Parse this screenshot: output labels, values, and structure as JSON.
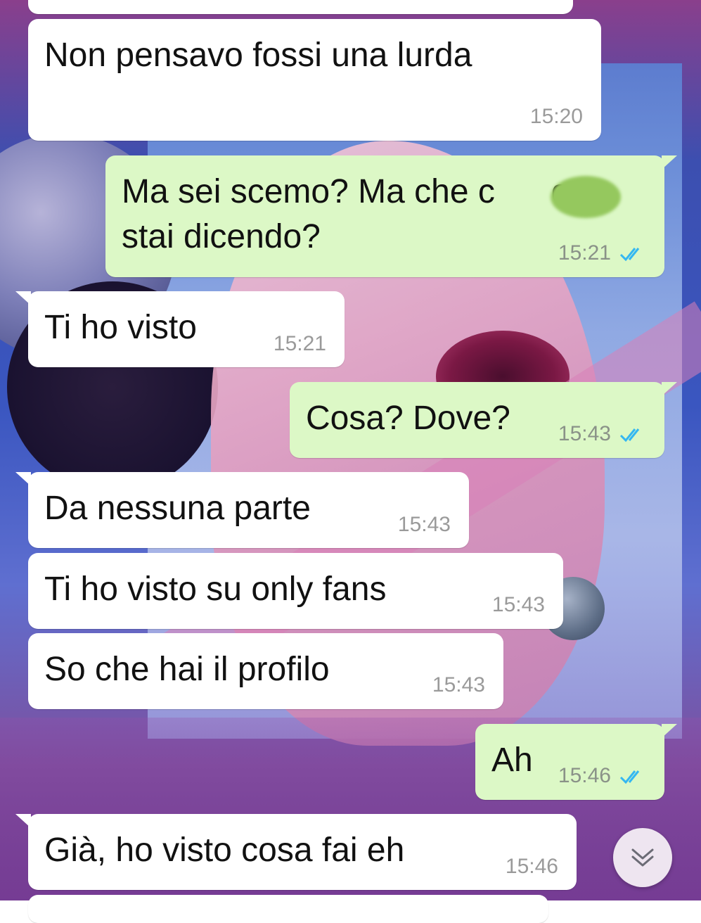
{
  "messages": [
    {
      "text": "Non pensavo fossi una lurda",
      "time": "15:20",
      "direction": "incoming"
    },
    {
      "text": "Ma sei scemo? Ma che c      o\nstai dicendo?",
      "time": "15:21",
      "direction": "outgoing",
      "status": "read"
    },
    {
      "text": "Ti ho visto",
      "time": "15:21",
      "direction": "incoming"
    },
    {
      "text": "Cosa? Dove?",
      "time": "15:43",
      "direction": "outgoing",
      "status": "read"
    },
    {
      "text": "Da nessuna parte",
      "time": "15:43",
      "direction": "incoming"
    },
    {
      "text": "Ti ho visto su only fans",
      "time": "15:43",
      "direction": "incoming"
    },
    {
      "text": "So che hai il profilo",
      "time": "15:43",
      "direction": "incoming"
    },
    {
      "text": "Ah",
      "time": "15:46",
      "direction": "outgoing",
      "status": "read"
    },
    {
      "text": "Già, ho visto cosa fai eh",
      "time": "15:46",
      "direction": "incoming"
    }
  ],
  "icons": {
    "read_receipt": "double-check-icon",
    "scroll_down": "chevron-double-down-icon"
  },
  "colors": {
    "incoming_bubble": "#ffffff",
    "outgoing_bubble": "#dcf8c6",
    "read_ticks": "#34b7f1",
    "censor_blob": "#95c85e"
  }
}
